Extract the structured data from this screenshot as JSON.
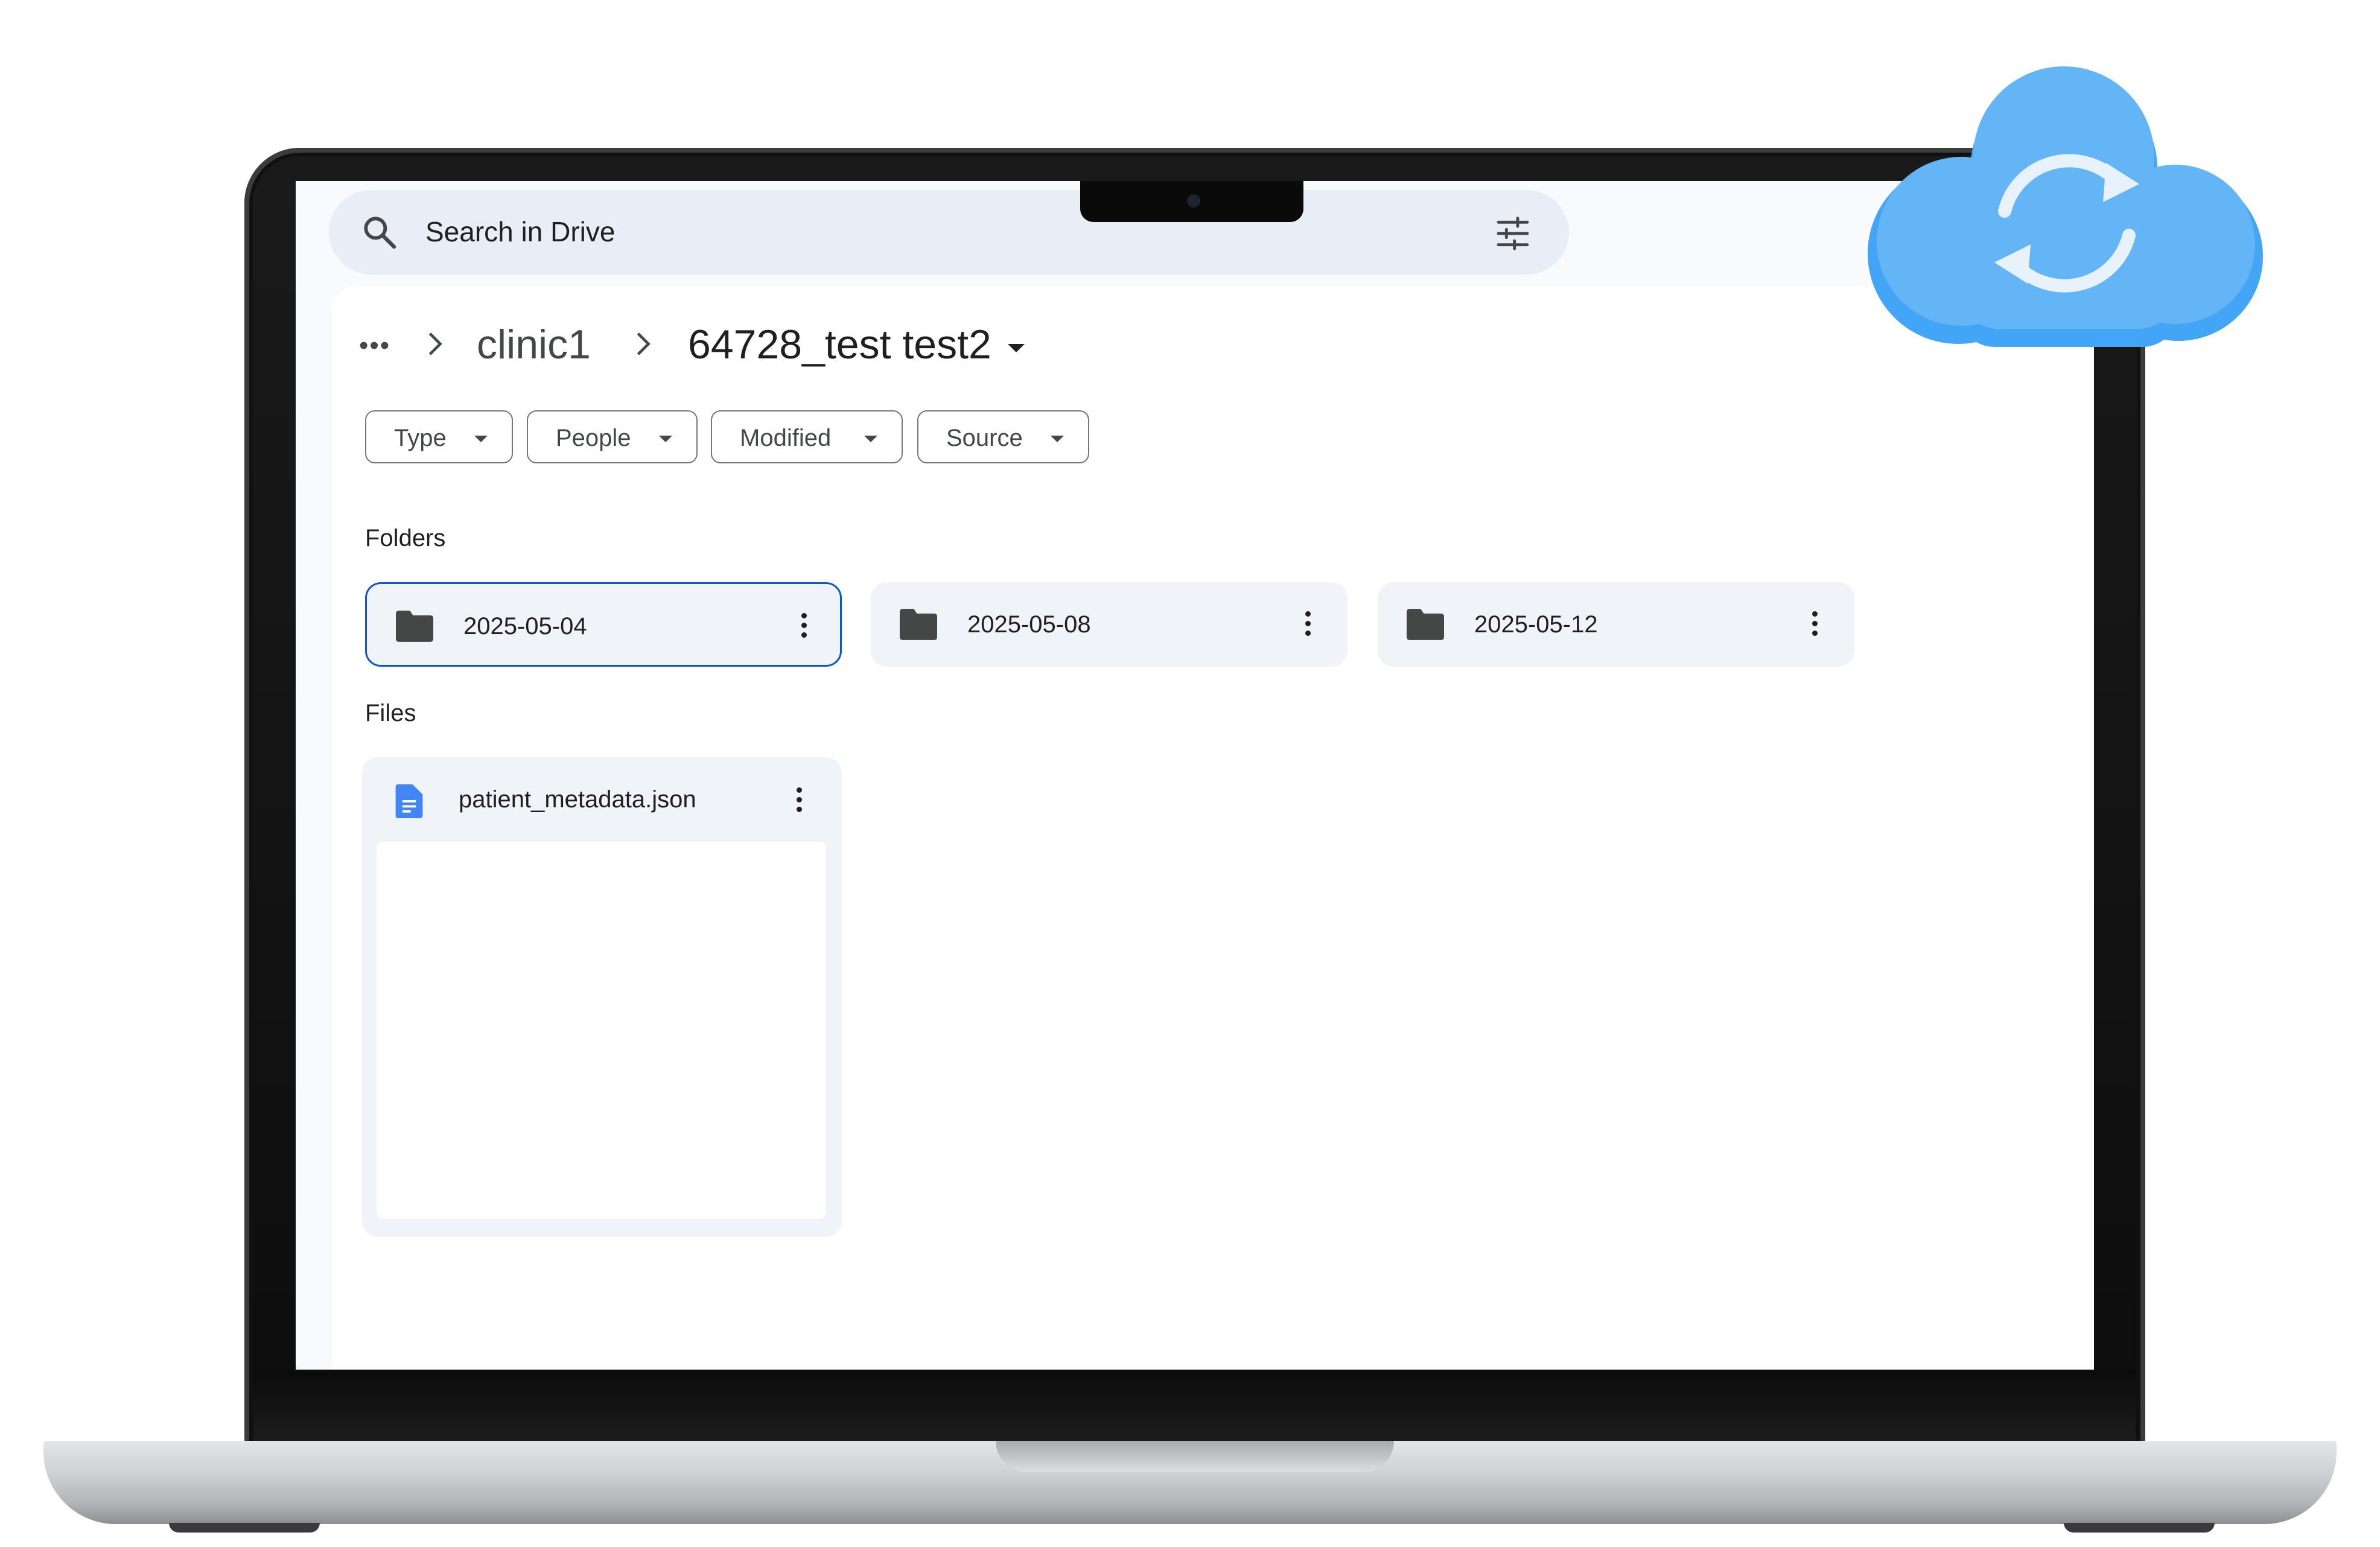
{
  "search": {
    "placeholder": "Search in Drive"
  },
  "breadcrumb": {
    "more": "•••",
    "parent": "clinic1",
    "current": "64728_test test2"
  },
  "filters": [
    {
      "label": "Type"
    },
    {
      "label": "People"
    },
    {
      "label": "Modified"
    },
    {
      "label": "Source"
    }
  ],
  "sections": {
    "folders": "Folders",
    "files": "Files"
  },
  "folders": [
    {
      "name": "2025-05-04",
      "selected": true
    },
    {
      "name": "2025-05-08",
      "selected": false
    },
    {
      "name": "2025-05-12",
      "selected": false
    }
  ],
  "files": [
    {
      "name": "patient_metadata.json",
      "icon": "doc-icon"
    }
  ],
  "colors": {
    "accent": "#0b57d0",
    "cloud": "#64b5f6",
    "doc_icon": "#4285f4"
  },
  "icons": {
    "search": "search-icon",
    "tune": "tune-icon",
    "folder": "folder-icon",
    "more": "more-vert-icon",
    "cloud": "cloud-sync-icon"
  }
}
